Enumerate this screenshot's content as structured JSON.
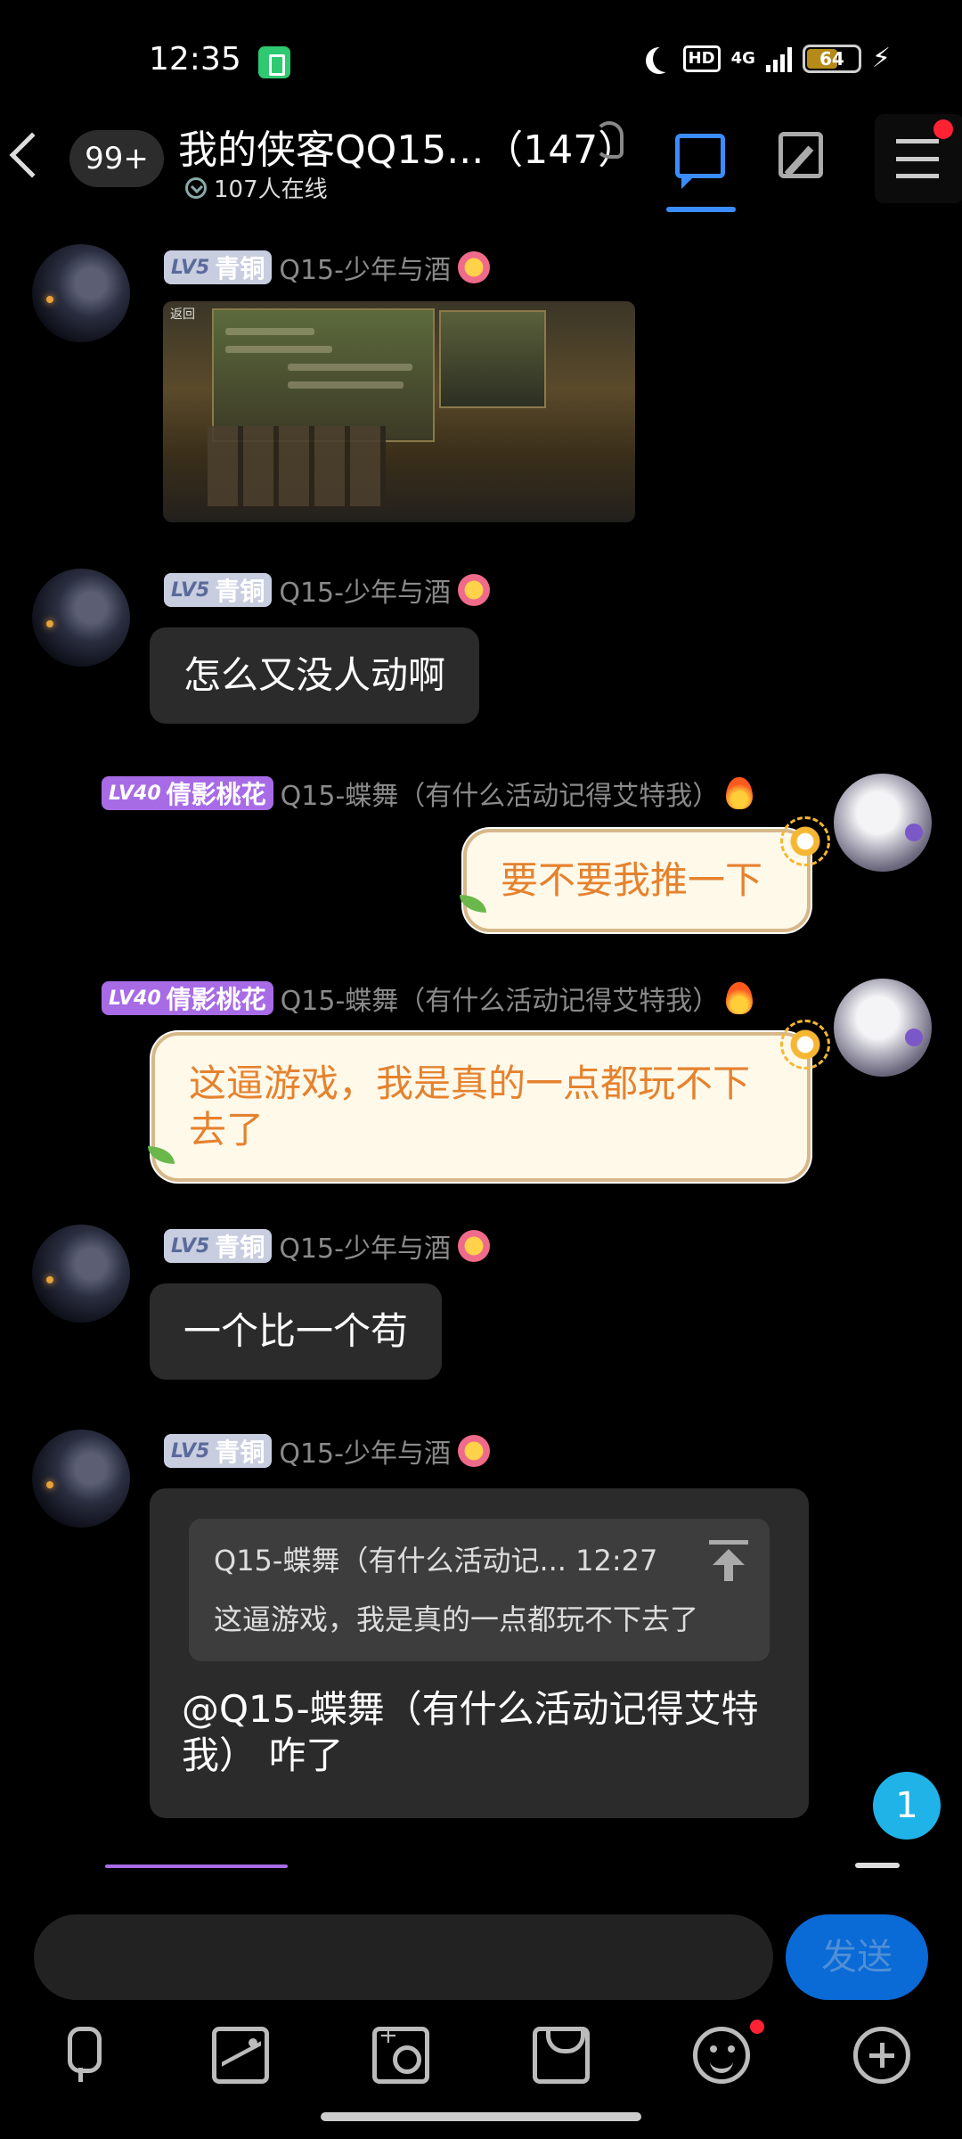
{
  "status_bar": {
    "time": "12:35",
    "hd": "HD",
    "network": "4G",
    "battery": "64",
    "battery_level": 0.64
  },
  "header": {
    "unread_count": "99+",
    "group_title": "我的侠客QQ15...（147）",
    "online_count": "107人在线"
  },
  "messages": [
    {
      "badge_level": "LV5",
      "badge_title": "青铜",
      "sender": "Q15-少年与酒",
      "type": "image"
    },
    {
      "badge_level": "LV5",
      "badge_title": "青铜",
      "sender": "Q15-少年与酒",
      "text": "怎么又没人动啊"
    },
    {
      "badge_level": "LV40",
      "badge_title": "倩影桃花",
      "sender": "Q15-蝶舞（有什么活动记得艾特我）",
      "text": "要不要我推一下"
    },
    {
      "badge_level": "LV40",
      "badge_title": "倩影桃花",
      "sender": "Q15-蝶舞（有什么活动记得艾特我）",
      "text": "这逼游戏，我是真的一点都玩不下去了"
    },
    {
      "badge_level": "LV5",
      "badge_title": "青铜",
      "sender": "Q15-少年与酒",
      "text": "一个比一个苟"
    },
    {
      "badge_level": "LV5",
      "badge_title": "青铜",
      "sender": "Q15-少年与酒",
      "quote_header": "Q15-蝶舞（有什么活动记... 12:27",
      "quote_text": "这逼游戏，我是真的一点都玩不下去了",
      "text": "@Q15-蝶舞（有什么活动记得艾特我） 咋了"
    }
  ],
  "screenshot_thumb": {
    "back_label": "返回"
  },
  "new_message_count": "1",
  "composer": {
    "send_label": "发送",
    "placeholder": ""
  },
  "toolbar_icons": [
    "mic-icon",
    "image-icon",
    "camera-icon",
    "redpacket-icon",
    "emoji-icon",
    "plus-icon"
  ]
}
